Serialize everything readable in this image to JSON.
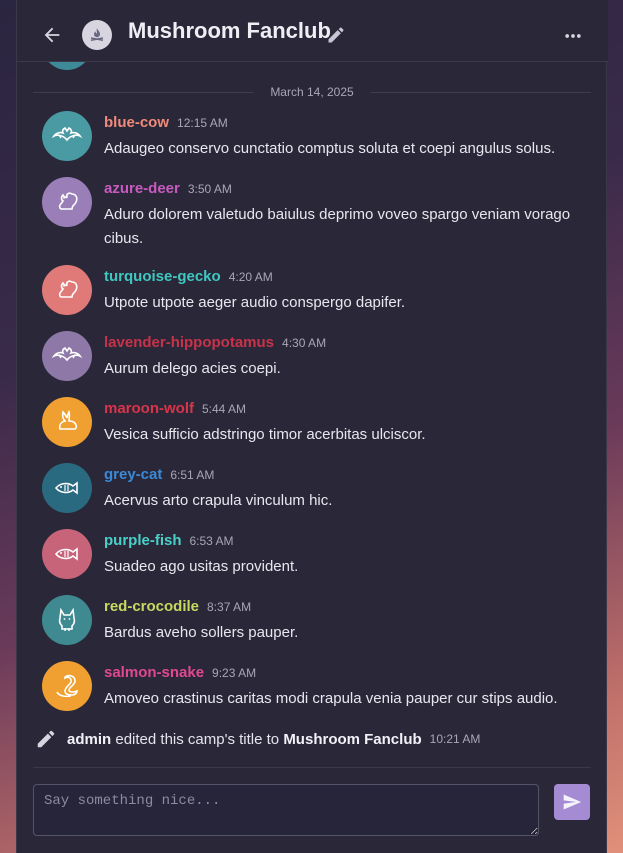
{
  "header": {
    "title": "Mushroom Fanclub",
    "icons": {
      "back": "arrow-left-icon",
      "camp": "campfire-icon",
      "edit": "pencil-icon",
      "more": "more-horizontal-icon"
    }
  },
  "date_separator": "March 14, 2025",
  "messages": [
    {
      "user": "blue-cow",
      "time": "12:15 AM",
      "text": "Adaugeo conservo cunctatio comptus soluta et coepi angulus solus.",
      "name_color": "#f08a7a",
      "avatar_color": "#4a9aa3",
      "icon": "bat-icon"
    },
    {
      "user": "azure-deer",
      "time": "3:50 AM",
      "text": "Aduro dolorem valetudo baiulus deprimo voveo spargo veniam vorago cibus.",
      "name_color": "#c85ac0",
      "avatar_color": "#9a7eb8",
      "icon": "squirrel-icon"
    },
    {
      "user": "turquoise-gecko",
      "time": "4:20 AM",
      "text": "Utpote utpote aeger audio conspergo dapifer.",
      "name_color": "#3ec8c0",
      "avatar_color": "#e07a78",
      "icon": "squirrel-icon"
    },
    {
      "user": "lavender-hippopotamus",
      "time": "4:30 AM",
      "text": "Aurum delego acies coepi.",
      "name_color": "#c8324a",
      "avatar_color": "#8e78a8",
      "icon": "bat-icon"
    },
    {
      "user": "maroon-wolf",
      "time": "5:44 AM",
      "text": "Vesica sufficio adstringo timor acerbitas ulciscor.",
      "name_color": "#d8344a",
      "avatar_color": "#f0a030",
      "icon": "rabbit-icon"
    },
    {
      "user": "grey-cat",
      "time": "6:51 AM",
      "text": "Acervus arto crapula vinculum hic.",
      "name_color": "#3a8ad8",
      "avatar_color": "#2a6a80",
      "icon": "fish-icon"
    },
    {
      "user": "purple-fish",
      "time": "6:53 AM",
      "text": "Suadeo ago usitas provident.",
      "name_color": "#4ad0c8",
      "avatar_color": "#c8647a",
      "icon": "fish-icon"
    },
    {
      "user": "red-crocodile",
      "time": "8:37 AM",
      "text": "Bardus aveho sollers pauper.",
      "name_color": "#c8d860",
      "avatar_color": "#3e8a90",
      "icon": "dog-icon"
    },
    {
      "user": "salmon-snake",
      "time": "9:23 AM",
      "text": "Amoveo crastinus caritas modi crapula venia pauper cur stips audio.",
      "name_color": "#e04890",
      "avatar_color": "#f0a030",
      "icon": "swan-icon"
    }
  ],
  "system_event": {
    "actor": "admin",
    "action": "edited this camp's title to",
    "target": "Mushroom Fanclub",
    "time": "10:21 AM",
    "icon": "pencil-icon"
  },
  "composer": {
    "placeholder": "Say something nice...",
    "send_icon": "send-icon"
  },
  "colors": {
    "accent": "#a48bd4",
    "panel": "#2a2838"
  }
}
